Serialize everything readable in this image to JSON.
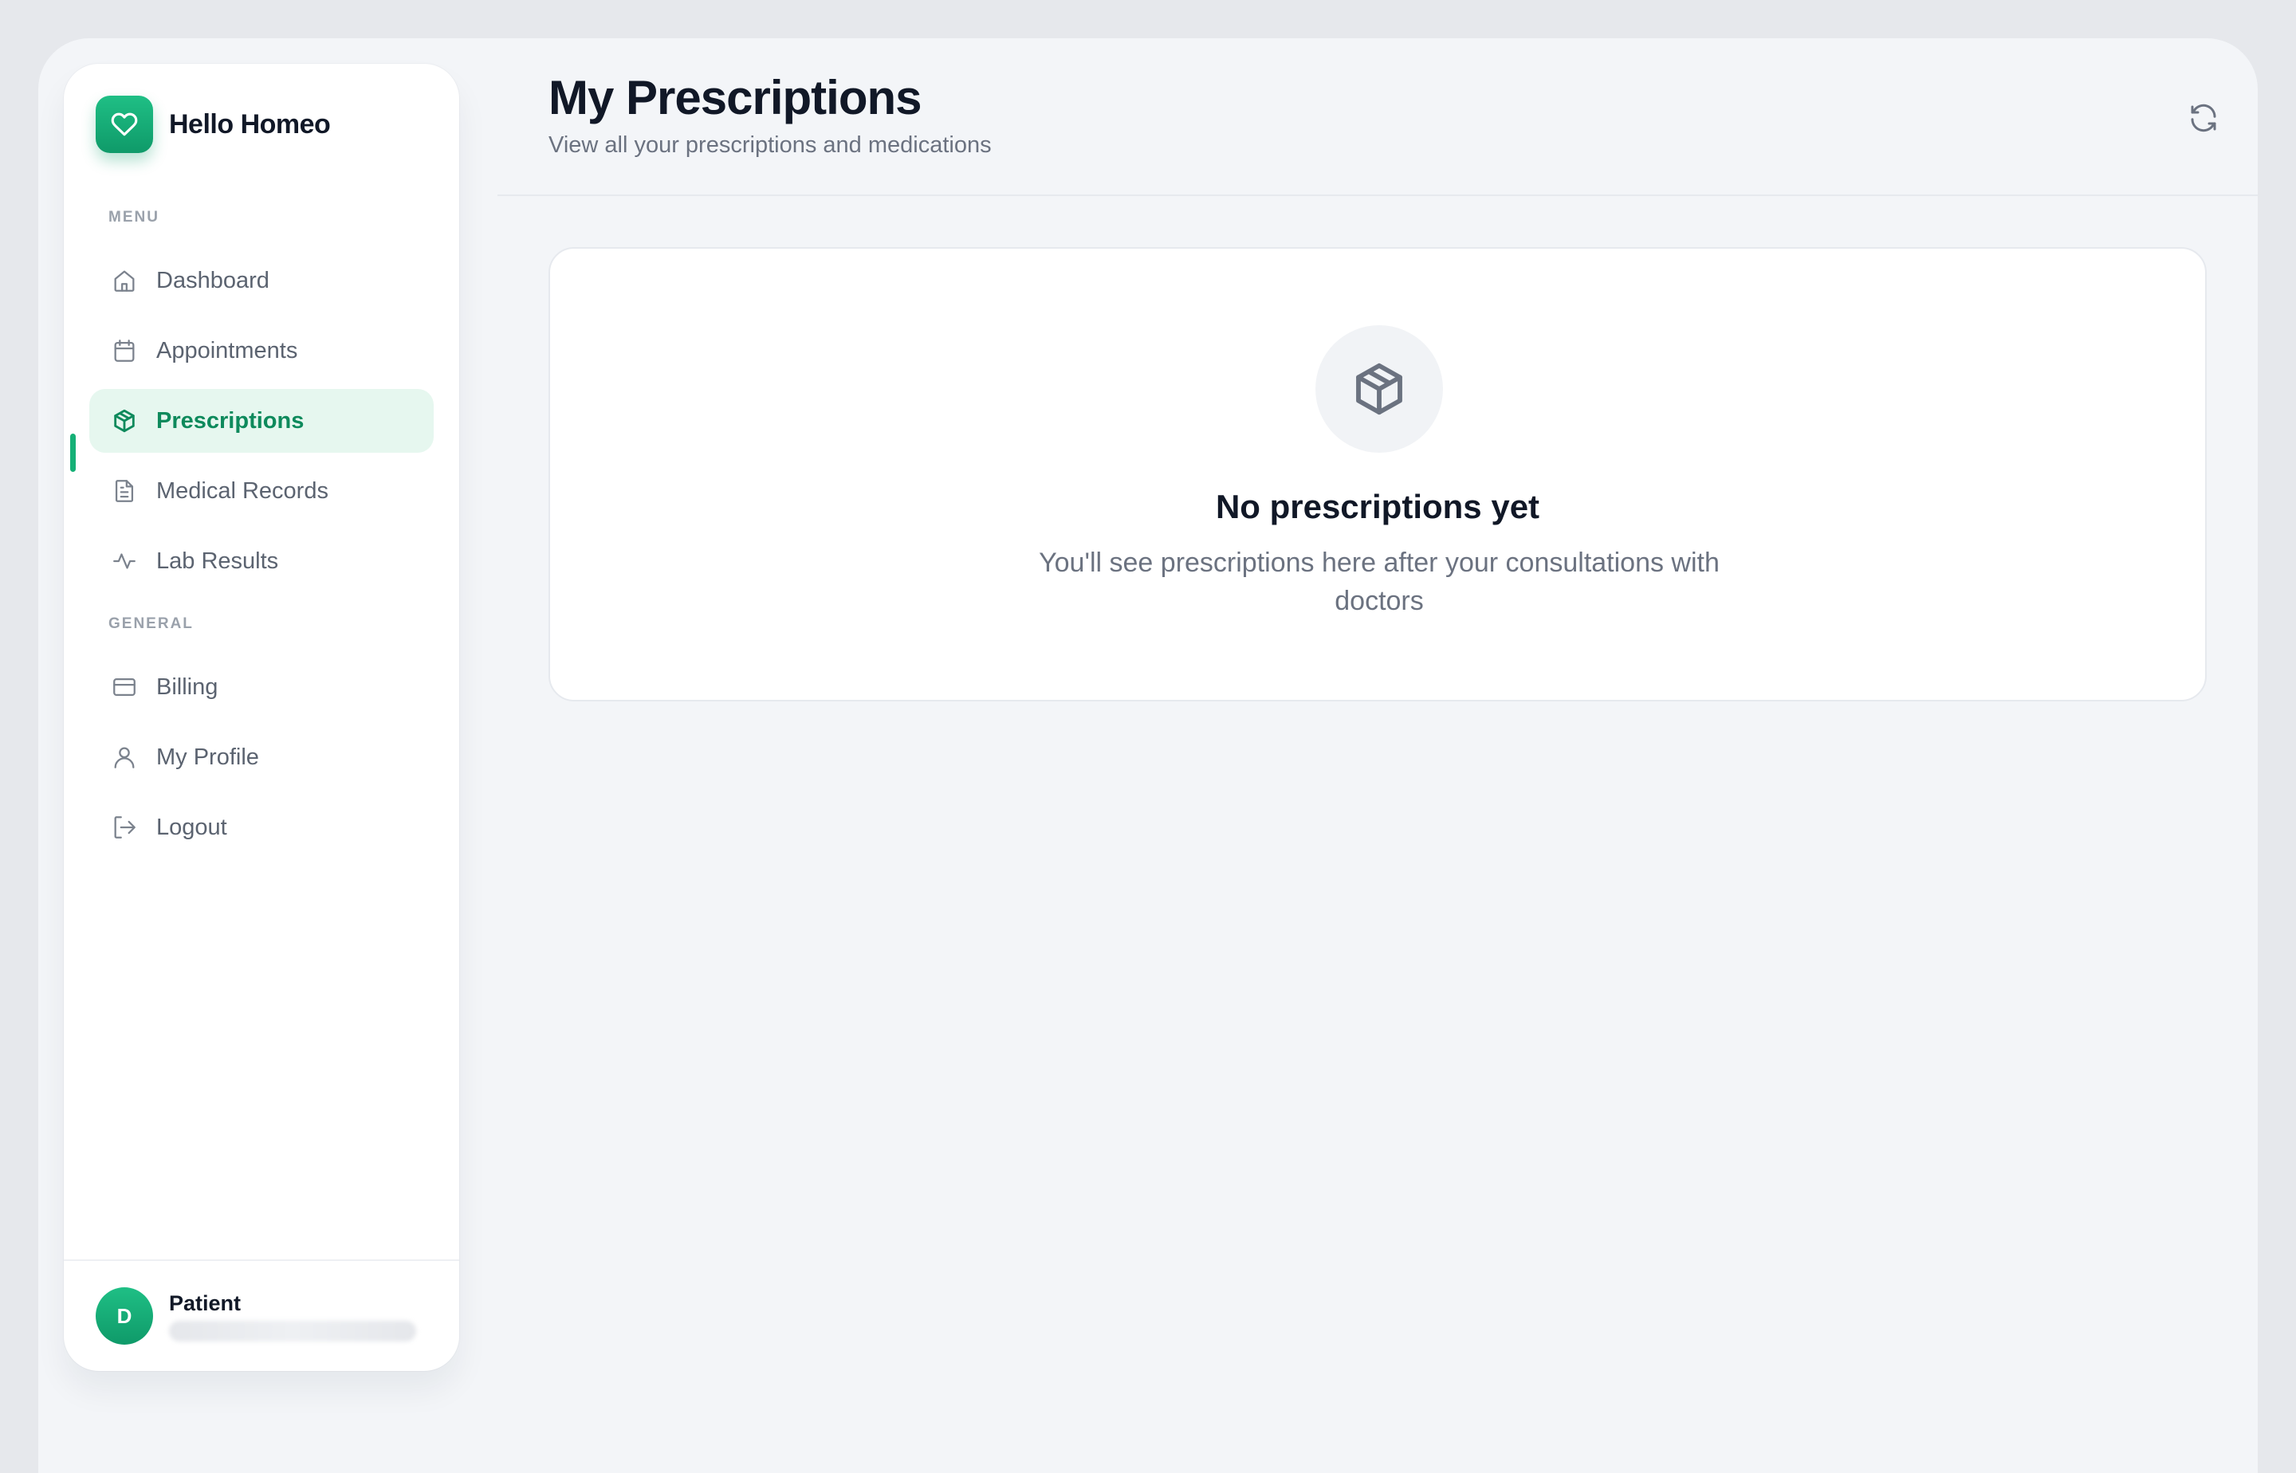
{
  "brand": {
    "name": "Hello Homeo",
    "accent": "#15b076"
  },
  "sidebar": {
    "menu_label": "MENU",
    "general_label": "GENERAL",
    "menu_items": [
      {
        "label": "Dashboard",
        "icon": "home-icon"
      },
      {
        "label": "Appointments",
        "icon": "calendar-icon"
      },
      {
        "label": "Prescriptions",
        "icon": "package-icon",
        "active": true
      },
      {
        "label": "Medical Records",
        "icon": "file-text-icon"
      },
      {
        "label": "Lab Results",
        "icon": "activity-icon"
      }
    ],
    "general_items": [
      {
        "label": "Billing",
        "icon": "credit-card-icon"
      },
      {
        "label": "My Profile",
        "icon": "user-icon"
      },
      {
        "label": "Logout",
        "icon": "logout-icon"
      }
    ]
  },
  "user": {
    "initial": "D",
    "role": "Patient"
  },
  "header": {
    "title": "My Prescriptions",
    "subtitle": "View all your prescriptions and medications"
  },
  "empty_state": {
    "title": "No prescriptions yet",
    "description": "You'll see prescriptions here after your consultations with doctors"
  }
}
